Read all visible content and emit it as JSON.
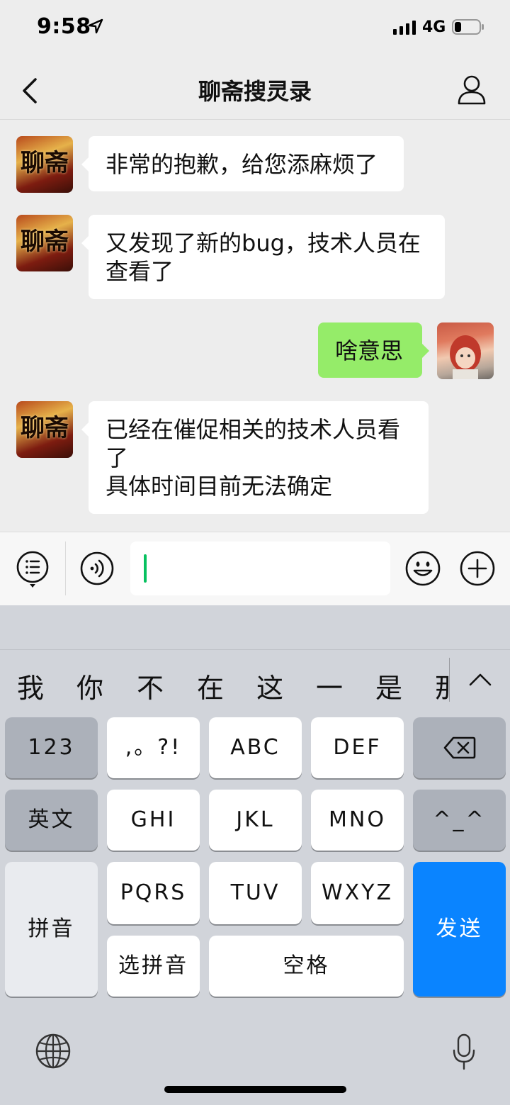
{
  "status_bar": {
    "time": "9:58",
    "network": "4G"
  },
  "nav": {
    "title": "聊斋搜灵录",
    "back_icon": "chevron-left-icon",
    "profile_icon": "person-icon"
  },
  "messages": [
    {
      "sender": "other",
      "text": "非常的抱歉，给您添麻烦了"
    },
    {
      "sender": "other",
      "line1": "又发现了新的bug，技术人员在",
      "line2": "查看了"
    },
    {
      "sender": "me",
      "text": "啥意思"
    },
    {
      "sender": "other",
      "line1": "已经在催促相关的技术人员看",
      "line2": "了",
      "line3": "具体时间目前无法确定"
    }
  ],
  "avatar_text": "聊斋",
  "input_bar": {
    "menu_icon": "list-menu-icon",
    "voice_icon": "voice-icon",
    "emoji_icon": "emoji-icon",
    "add_icon": "plus-circle-icon",
    "value": ""
  },
  "keyboard": {
    "candidates": [
      "我",
      "你",
      "不",
      "在",
      "这",
      "一",
      "是",
      "那"
    ],
    "keys": {
      "num": "123",
      "punct": ",。?!",
      "abc": "ABC",
      "def": "DEF",
      "english": "英文",
      "ghi": "GHI",
      "jkl": "JKL",
      "mno": "MNO",
      "face": "^_^",
      "pinyin": "拼音",
      "pqrs": "PQRS",
      "tuv": "TUV",
      "wxyz": "WXYZ",
      "send": "发送",
      "select_pinyin": "选拼音",
      "space": "空格"
    },
    "globe_icon": "globe-icon",
    "mic_icon": "microphone-icon",
    "delete_icon": "backspace-icon"
  },
  "colors": {
    "chat_bg": "#ededed",
    "my_bubble": "#95ec69",
    "send_key": "#0a84ff",
    "caret": "#07c160"
  }
}
